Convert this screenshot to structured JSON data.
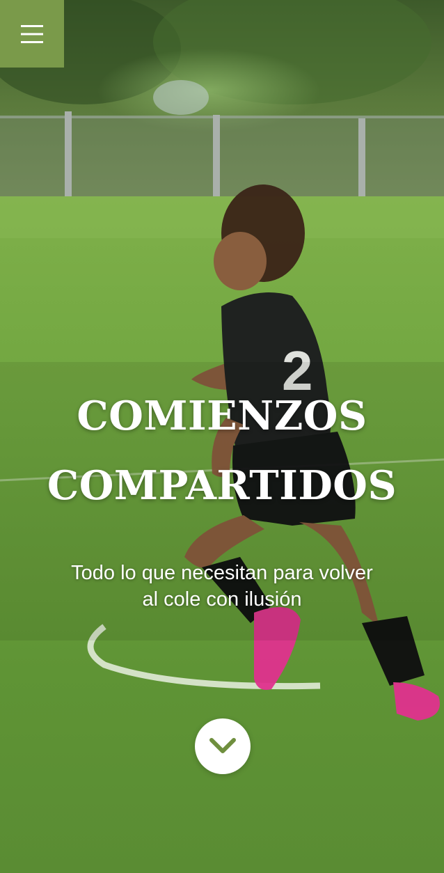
{
  "hero": {
    "title_line1": "COMIENZOS",
    "title_line2": "COMPARTIDOS",
    "subtitle_line1": "Todo lo que necesitan para volver",
    "subtitle_line2": "al cole con ilusión",
    "background_scene": "girl-playing-soccer-on-grass-field"
  },
  "menu": {
    "icon": "hamburger-menu-icon"
  },
  "scroll": {
    "icon": "chevron-down-icon"
  },
  "colors": {
    "accent": "#7a9a4a",
    "text": "#ffffff",
    "grass": "#5e8f3b"
  }
}
